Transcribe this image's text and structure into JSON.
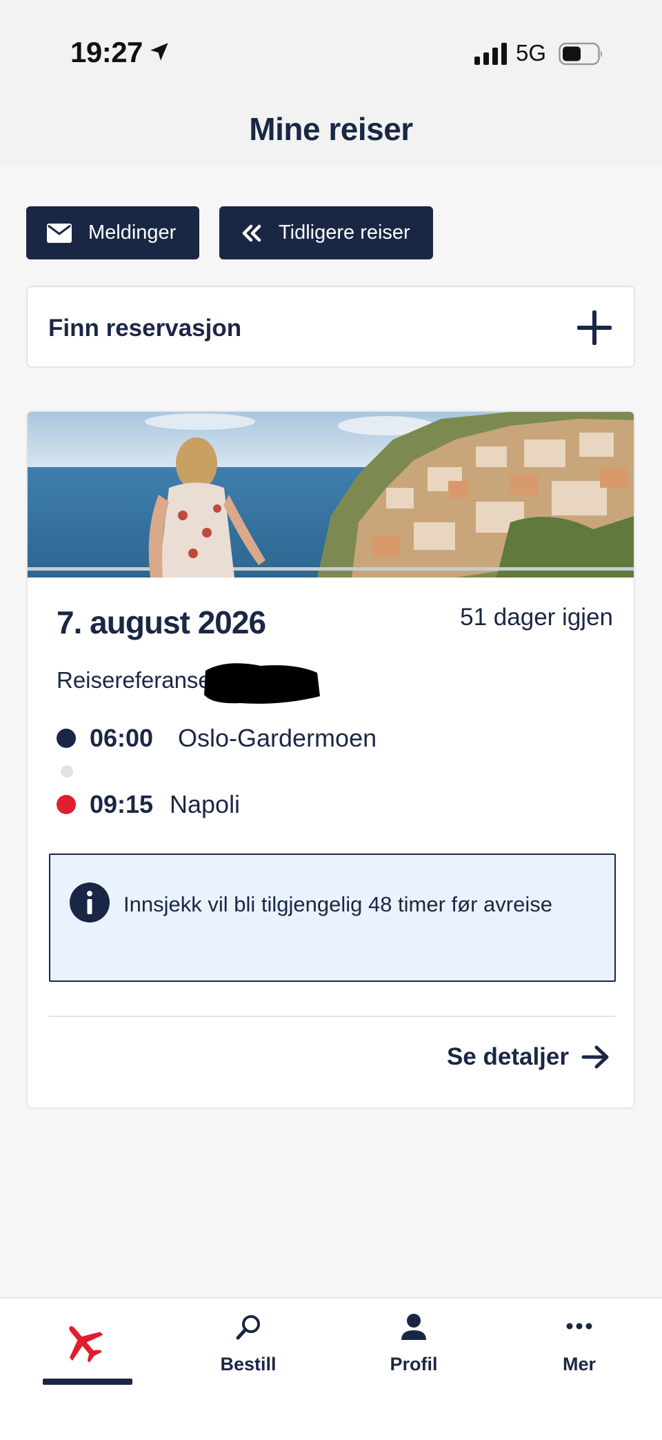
{
  "status_bar": {
    "time": "19:27",
    "network": "5G"
  },
  "header": {
    "title": "Mine reiser"
  },
  "actions": {
    "messages_label": "Meldinger",
    "previous_trips_label": "Tidligere reiser"
  },
  "find_reservation": {
    "label": "Finn reservasjon"
  },
  "trip": {
    "date": "7. august 2026",
    "days_left": "51 dager igjen",
    "reference_label": "Reisereferanse",
    "departure": {
      "time": "06:00",
      "place": "Oslo-Gardermoen"
    },
    "arrival": {
      "time": "09:15",
      "place": "Napoli"
    },
    "info_text": "Innsjekk vil bli tilgjengelig 48 timer før avreise",
    "details_label": "Se detaljer"
  },
  "bottom_nav": {
    "items": [
      {
        "label": "",
        "icon": "airplane-icon",
        "active": true
      },
      {
        "label": "Bestill",
        "icon": "search-icon",
        "active": false
      },
      {
        "label": "Profil",
        "icon": "user-icon",
        "active": false
      },
      {
        "label": "Mer",
        "icon": "more-icon",
        "active": false
      }
    ]
  },
  "colors": {
    "navy": "#1a2744",
    "accent_red": "#e01e2d",
    "info_bg": "#eaf2fd",
    "page_bg": "#f6f6f6"
  }
}
